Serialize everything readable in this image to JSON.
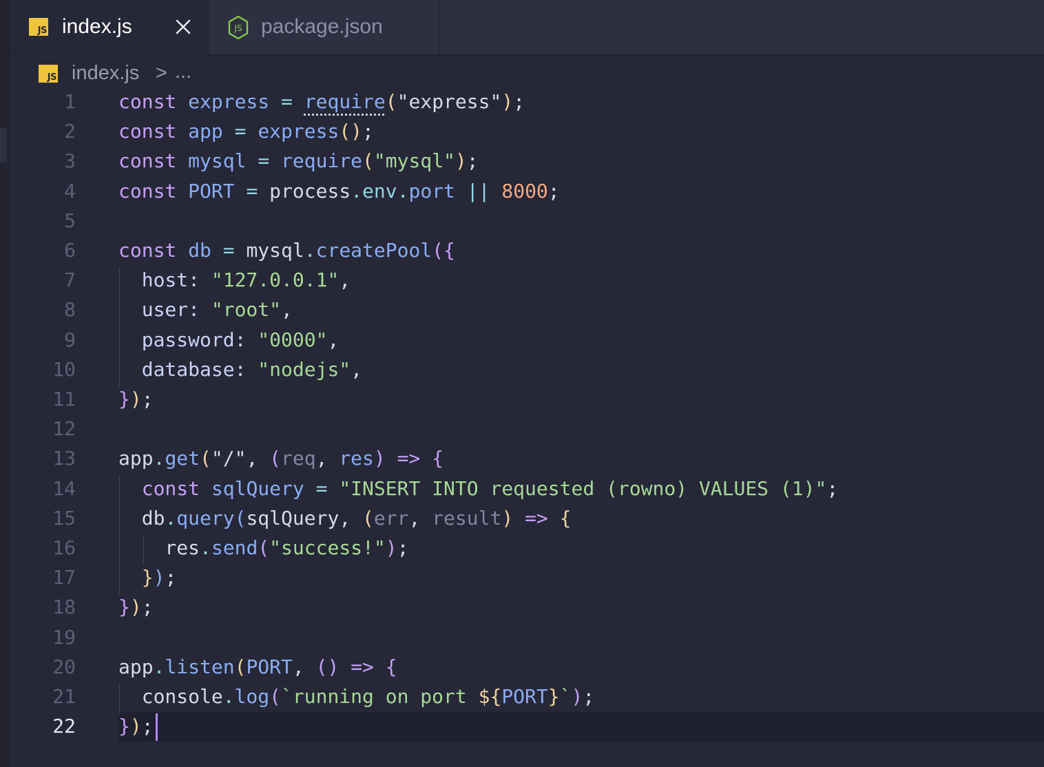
{
  "tabs": [
    {
      "label": "index.js",
      "icon": "js-file-icon",
      "active": true
    },
    {
      "label": "package.json",
      "icon": "nodejs-icon",
      "active": false
    }
  ],
  "breadcrumb": {
    "file": "index.js",
    "separator": ">",
    "more": "..."
  },
  "editor": {
    "current_line": 22,
    "line_numbers": [
      "1",
      "2",
      "3",
      "4",
      "5",
      "6",
      "7",
      "8",
      "9",
      "10",
      "11",
      "12",
      "13",
      "14",
      "15",
      "16",
      "17",
      "18",
      "19",
      "20",
      "21",
      "22"
    ]
  },
  "code": {
    "l1": {
      "a": "const",
      "b": " ",
      "c": "express",
      "d": " ",
      "e": "=",
      "f": " ",
      "g": "require",
      "h": "(",
      "i": "\"express\"",
      "j": ")",
      "k": ";"
    },
    "l2": {
      "a": "const",
      "b": " ",
      "c": "app",
      "d": " ",
      "e": "=",
      "f": " ",
      "g": "express",
      "h": "()",
      "i": ";"
    },
    "l3": {
      "a": "const",
      "b": " ",
      "c": "mysql",
      "d": " ",
      "e": "=",
      "f": " ",
      "g": "require",
      "h": "(",
      "i": "\"mysql\"",
      "j": ")",
      "k": ";"
    },
    "l4": {
      "a": "const",
      "b": " ",
      "c": "PORT",
      "d": " ",
      "e": "=",
      "f": " ",
      "g": "process",
      "h": ".",
      "i": "env",
      "j": ".",
      "k": "port",
      "l": " ",
      "m": "||",
      "n": " ",
      "o": "8000",
      "p": ";"
    },
    "l6": {
      "a": "const",
      "b": " ",
      "c": "db",
      "d": " ",
      "e": "=",
      "f": " ",
      "g": "mysql",
      "h": ".",
      "i": "createPool",
      "j": "(",
      "k": "{"
    },
    "l7": {
      "a": "  host: ",
      "b": "\"127.0.0.1\"",
      "c": ","
    },
    "l8": {
      "a": "  user: ",
      "b": "\"root\"",
      "c": ","
    },
    "l9": {
      "a": "  password: ",
      "b": "\"0000\"",
      "c": ","
    },
    "l10": {
      "a": "  database: ",
      "b": "\"nodejs\"",
      "c": ","
    },
    "l11": {
      "a": "}",
      "b": ")",
      "c": ";"
    },
    "l13": {
      "a": "app",
      "b": ".",
      "c": "get",
      "d": "(",
      "e": "\"/\"",
      "f": ", ",
      "g": "(",
      "h": "req",
      "i": ", ",
      "j": "res",
      "k": ")",
      "l": " ",
      "m": "=>",
      "n": " ",
      "o": "{"
    },
    "l14": {
      "a": "  ",
      "b": "const",
      "c": " ",
      "d": "sqlQuery",
      "e": " ",
      "f": "=",
      "g": " ",
      "h": "\"INSERT INTO requested (rowno) VALUES (1)\"",
      "i": ";"
    },
    "l15": {
      "a": "  db",
      "b": ".",
      "c": "query",
      "d": "(",
      "e": "sqlQuery, ",
      "f": "(",
      "g": "err",
      "h": ", ",
      "i": "result",
      "j": ")",
      "k": " ",
      "l": "=>",
      "m": " ",
      "n": "{"
    },
    "l16": {
      "a": "    res",
      "b": ".",
      "c": "send",
      "d": "(",
      "e": "\"success!\"",
      "f": ")",
      "g": ";"
    },
    "l17": {
      "a": "  ",
      "b": "}",
      "c": ")",
      "d": ";"
    },
    "l18": {
      "a": "}",
      "b": ")",
      "c": ";"
    },
    "l20": {
      "a": "app",
      "b": ".",
      "c": "listen",
      "d": "(",
      "e": "PORT",
      "f": ", ",
      "g": "()",
      "h": " ",
      "i": "=>",
      "j": " ",
      "k": "{"
    },
    "l21": {
      "a": "  console",
      "b": ".",
      "c": "log",
      "d": "(",
      "e": "`running on port ",
      "f": "${",
      "g": "PORT",
      "h": "}",
      "i": "`",
      "j": ")",
      "k": ";"
    },
    "l22": {
      "a": "}",
      "b": ")",
      "c": ";"
    }
  }
}
